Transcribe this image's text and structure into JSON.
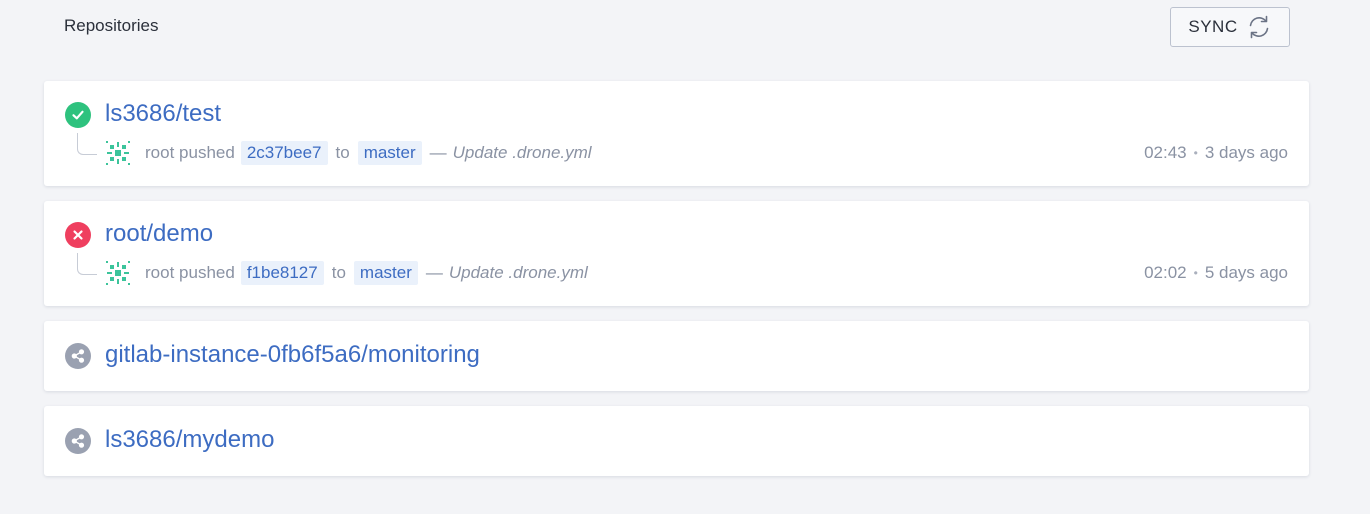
{
  "header": {
    "title": "Repositories"
  },
  "sync": {
    "label": "SYNC",
    "icon": "sync-icon"
  },
  "colors": {
    "success": "#2ec27e",
    "failure": "#ef3f5f",
    "inactive": "#9aa1b1",
    "link": "#3d6cc2"
  },
  "repos": [
    {
      "name": "ls3686/test",
      "status": "success",
      "status_icon": "check-circle-icon",
      "commit": {
        "author": "root",
        "action": "pushed",
        "sha": "2c37bee7",
        "to": "to",
        "branch": "master",
        "separator": "—",
        "message": "Update .drone.yml"
      },
      "time": "02:43",
      "ago": "3 days ago"
    },
    {
      "name": "root/demo",
      "status": "failure",
      "status_icon": "x-circle-icon",
      "commit": {
        "author": "root",
        "action": "pushed",
        "sha": "f1be8127",
        "to": "to",
        "branch": "master",
        "separator": "—",
        "message": "Update .drone.yml"
      },
      "time": "02:02",
      "ago": "5 days ago"
    },
    {
      "name": "gitlab-instance-0fb6f5a6/monitoring",
      "status": "inactive",
      "status_icon": "share-icon"
    },
    {
      "name": "ls3686/mydemo",
      "status": "inactive",
      "status_icon": "share-icon"
    }
  ]
}
